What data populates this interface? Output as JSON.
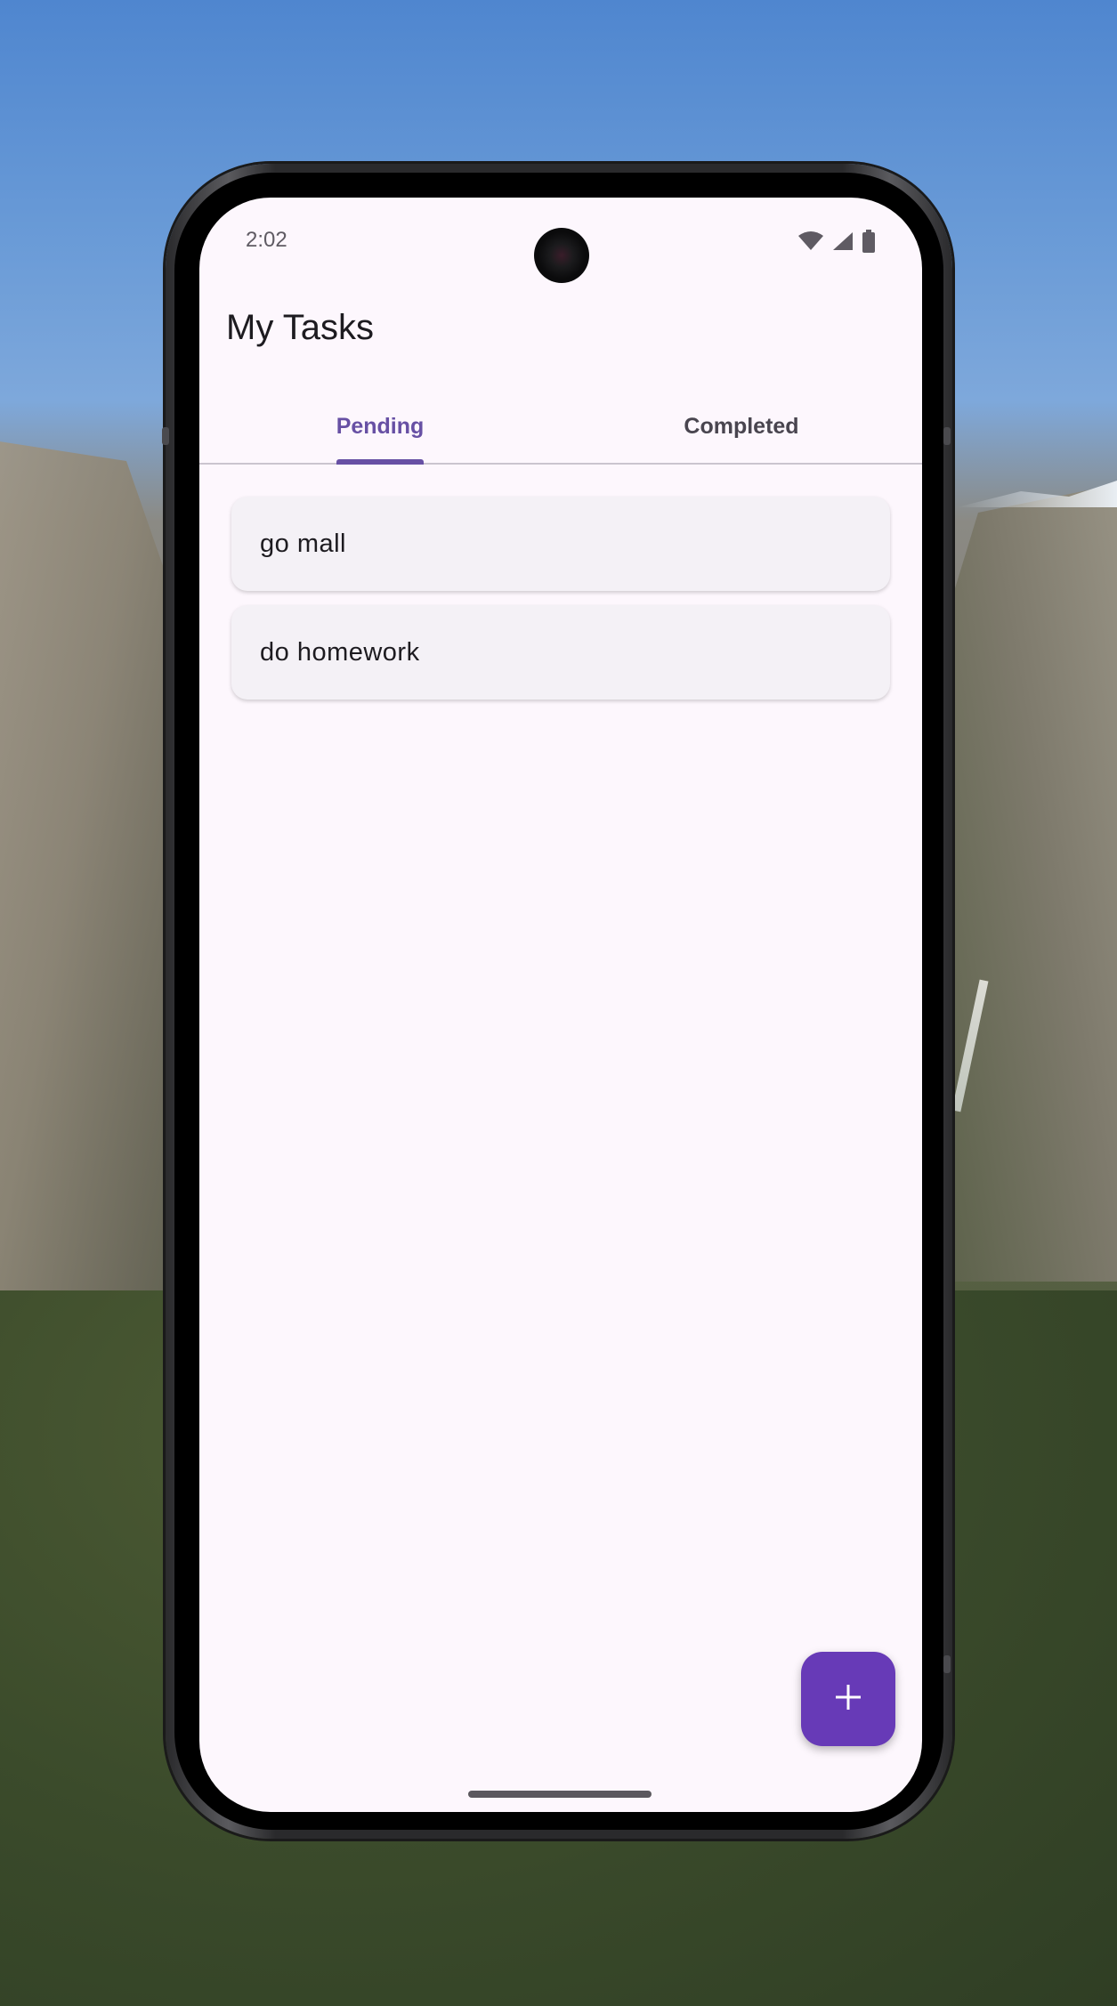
{
  "status_bar": {
    "time": "2:02",
    "icons": [
      "wifi-icon",
      "signal-icon",
      "battery-icon"
    ]
  },
  "app_bar": {
    "title": "My Tasks"
  },
  "tabs": [
    {
      "label": "Pending",
      "active": true
    },
    {
      "label": "Completed",
      "active": false
    }
  ],
  "tasks": [
    {
      "label": "go mall"
    },
    {
      "label": "do homework"
    }
  ],
  "fab": {
    "icon": "plus-icon"
  },
  "colors": {
    "accent": "#6750a4",
    "fab": "#673ab7",
    "surface": "#fdf7fd",
    "card": "#f4f1f6"
  }
}
